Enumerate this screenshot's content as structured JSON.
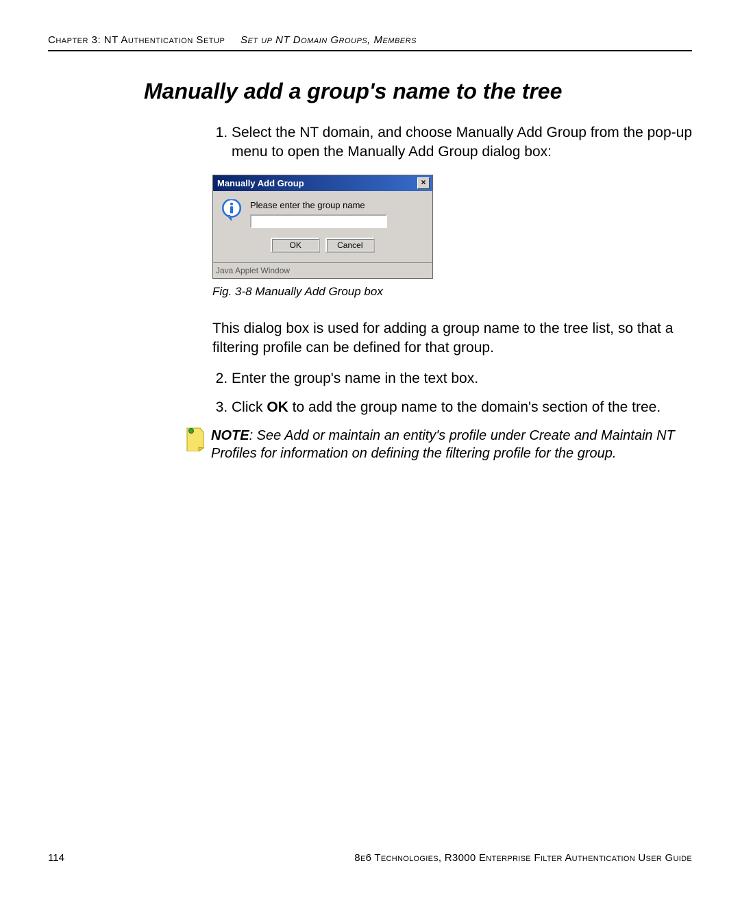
{
  "header": {
    "chapter": "Chapter 3: NT Authentication Setup",
    "section": "Set up NT Domain Groups, Members"
  },
  "title": "Manually add a group's name to the tree",
  "steps": {
    "s1": "Select the NT domain, and choose Manually Add Group from the pop-up menu to open the Manually Add Group dialog box:",
    "s2": "Enter the group's name in the text box.",
    "s3_pre": "Click ",
    "s3_bold": "OK",
    "s3_post": " to add the group name to the domain's section of the tree."
  },
  "dialog": {
    "title": "Manually Add Group",
    "close": "×",
    "prompt": "Please enter the group name",
    "ok": "OK",
    "cancel": "Cancel",
    "status": "Java Applet Window"
  },
  "fig_caption": "Fig. 3-8  Manually Add Group box",
  "after_fig_para": "This dialog box is used for adding a group name to the tree list, so that a filtering profile can be defined for that group.",
  "note": {
    "label": "NOTE",
    "text": ": See Add or maintain an entity's profile under Create and Maintain NT Profiles for information on defining the filtering profile for the group."
  },
  "footer": {
    "page": "114",
    "right": "8e6 Technologies, R3000 Enterprise Filter Authentication User Guide"
  }
}
